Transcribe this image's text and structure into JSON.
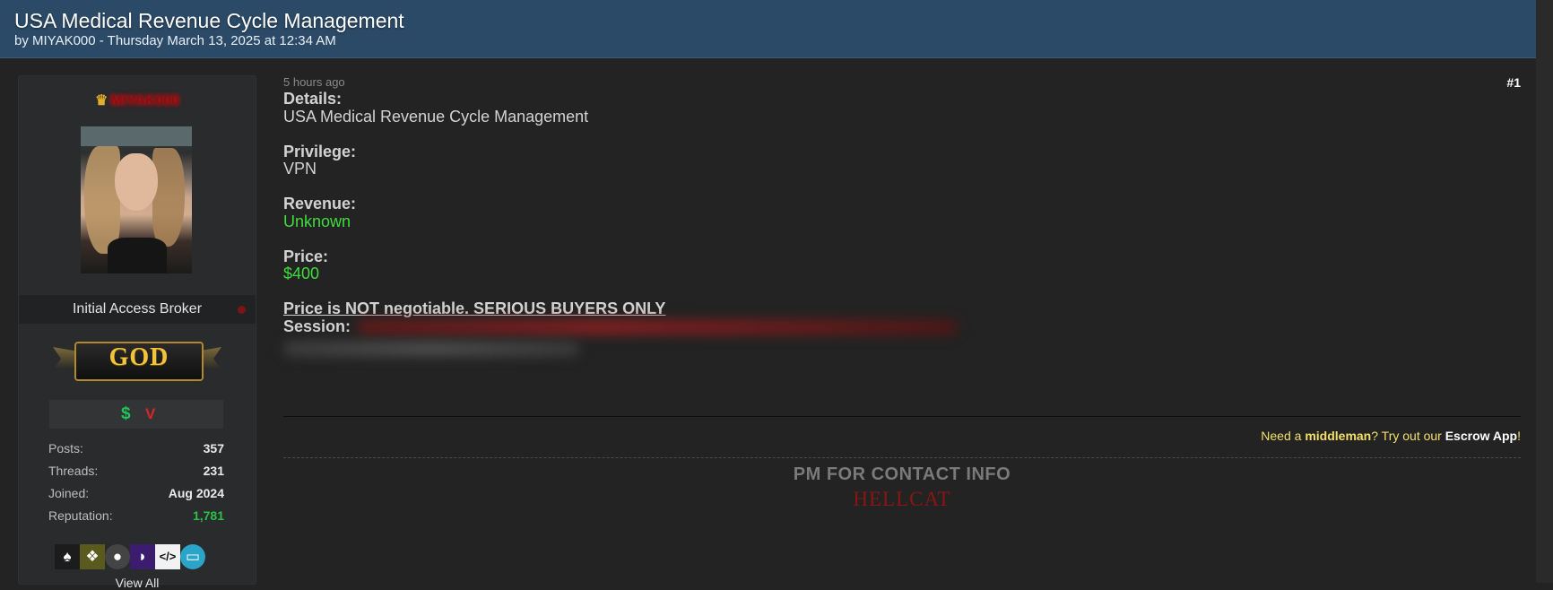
{
  "thread": {
    "title": "USA Medical Revenue Cycle Management",
    "byline": "by MIYAK000 - Thursday March 13, 2025 at 12:34 AM"
  },
  "user": {
    "name": "MIYAK000",
    "rank": "Initial Access Broker",
    "badge": "GOD",
    "award_icons": [
      "$",
      "V"
    ],
    "stats": [
      {
        "label": "Posts:",
        "value": "357"
      },
      {
        "label": "Threads:",
        "value": "231"
      },
      {
        "label": "Joined:",
        "value": "Aug 2024"
      },
      {
        "label": "Reputation:",
        "value": "1,781"
      }
    ],
    "view_all": "View All"
  },
  "post": {
    "time": "5 hours ago",
    "number": "#1",
    "fields": [
      {
        "label": "Details:",
        "value": "USA Medical Revenue Cycle Management"
      },
      {
        "label": "Privilege:",
        "value": "VPN"
      },
      {
        "label": "Revenue:",
        "value": "Unknown"
      },
      {
        "label": "Price:",
        "value": "$400"
      }
    ],
    "note": "Price is NOT negotiable. SERIOUS BUYERS ONLY",
    "session_label": "Session:",
    "escrow": {
      "prefix": "Need a ",
      "middleman": "middleman",
      "mid": "? Try out our ",
      "app": "Escrow App",
      "suffix": "!"
    },
    "signature": {
      "line1": "PM FOR CONTACT INFO",
      "line2": "HELLCAT"
    }
  }
}
